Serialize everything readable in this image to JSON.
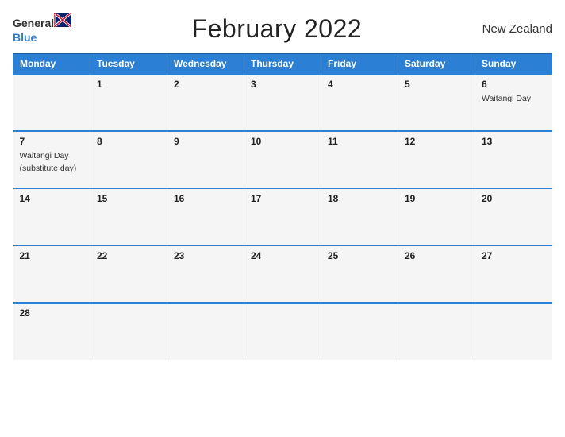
{
  "header": {
    "logo_general": "General",
    "logo_blue": "Blue",
    "title": "February 2022",
    "country": "New Zealand"
  },
  "weekdays": [
    "Monday",
    "Tuesday",
    "Wednesday",
    "Thursday",
    "Friday",
    "Saturday",
    "Sunday"
  ],
  "weeks": [
    [
      {
        "day": "",
        "events": []
      },
      {
        "day": "1",
        "events": []
      },
      {
        "day": "2",
        "events": []
      },
      {
        "day": "3",
        "events": []
      },
      {
        "day": "4",
        "events": []
      },
      {
        "day": "5",
        "events": []
      },
      {
        "day": "6",
        "events": [
          "Waitangi Day"
        ]
      }
    ],
    [
      {
        "day": "7",
        "events": [
          "Waitangi Day",
          "(substitute day)"
        ]
      },
      {
        "day": "8",
        "events": []
      },
      {
        "day": "9",
        "events": []
      },
      {
        "day": "10",
        "events": []
      },
      {
        "day": "11",
        "events": []
      },
      {
        "day": "12",
        "events": []
      },
      {
        "day": "13",
        "events": []
      }
    ],
    [
      {
        "day": "14",
        "events": []
      },
      {
        "day": "15",
        "events": []
      },
      {
        "day": "16",
        "events": []
      },
      {
        "day": "17",
        "events": []
      },
      {
        "day": "18",
        "events": []
      },
      {
        "day": "19",
        "events": []
      },
      {
        "day": "20",
        "events": []
      }
    ],
    [
      {
        "day": "21",
        "events": []
      },
      {
        "day": "22",
        "events": []
      },
      {
        "day": "23",
        "events": []
      },
      {
        "day": "24",
        "events": []
      },
      {
        "day": "25",
        "events": []
      },
      {
        "day": "26",
        "events": []
      },
      {
        "day": "27",
        "events": []
      }
    ],
    [
      {
        "day": "28",
        "events": []
      },
      {
        "day": "",
        "events": []
      },
      {
        "day": "",
        "events": []
      },
      {
        "day": "",
        "events": []
      },
      {
        "day": "",
        "events": []
      },
      {
        "day": "",
        "events": []
      },
      {
        "day": "",
        "events": []
      }
    ]
  ]
}
